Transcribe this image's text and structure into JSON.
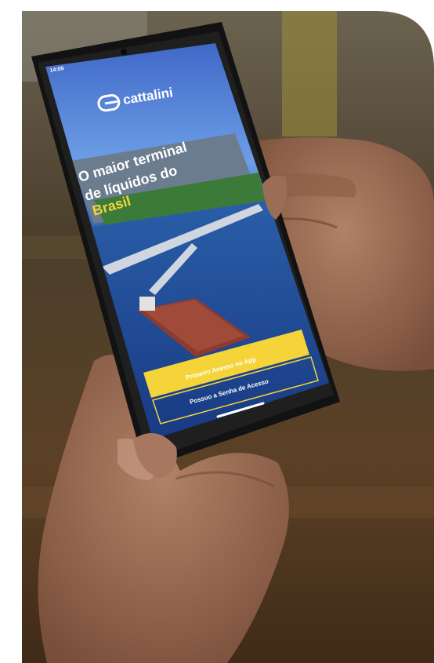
{
  "status_bar": {
    "time": "14:09"
  },
  "brand": {
    "name": "cattalini",
    "icon": "cattalini-logo-icon"
  },
  "hero": {
    "line1": "O maior terminal",
    "line2": "de líquidos do",
    "line3": "Brasil"
  },
  "buttons": {
    "primary_label": "Primeiro Acesso no App",
    "secondary_label": "Possuo a Senha de Acesso"
  },
  "colors": {
    "accent_yellow": "#f5d43a",
    "screen_blue": "#1c3f8a",
    "phone_frame": "#121212"
  }
}
